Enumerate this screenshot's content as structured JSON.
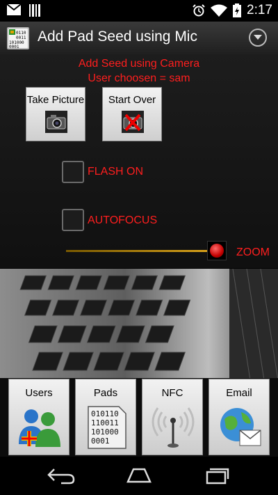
{
  "status_bar": {
    "time": "2:17",
    "icons": [
      "gmail-icon",
      "barcode-icon",
      "alarm-icon",
      "wifi-icon",
      "battery-icon"
    ]
  },
  "action_bar": {
    "title": "Add Pad Seed using Mic",
    "app_icon_text": [
      "0110",
      "0011",
      "101000",
      "0001"
    ]
  },
  "header": {
    "line1": "Add Seed using Camera",
    "line2": "User choosen = sam"
  },
  "buttons": {
    "take_picture": "Take Picture",
    "start_over": "Start Over"
  },
  "checkboxes": {
    "flash": {
      "label": "FLASH ON",
      "checked": false
    },
    "autofocus": {
      "label": "AUTOFOCUS",
      "checked": false
    }
  },
  "zoom": {
    "label": "ZOOM"
  },
  "tabs": [
    {
      "label": "Users",
      "icon": "users-add-icon"
    },
    {
      "label": "Pads",
      "icon": "pad-document-icon",
      "icon_text": [
        "010110",
        "110011",
        "101000",
        "0001"
      ]
    },
    {
      "label": "NFC",
      "icon": "nfc-antenna-icon"
    },
    {
      "label": "Email",
      "icon": "email-globe-icon"
    }
  ],
  "nav": [
    "back-icon",
    "home-icon",
    "recents-icon"
  ],
  "colors": {
    "accent_red": "#ff1e1e",
    "slider_gold": "#d9a21a"
  }
}
